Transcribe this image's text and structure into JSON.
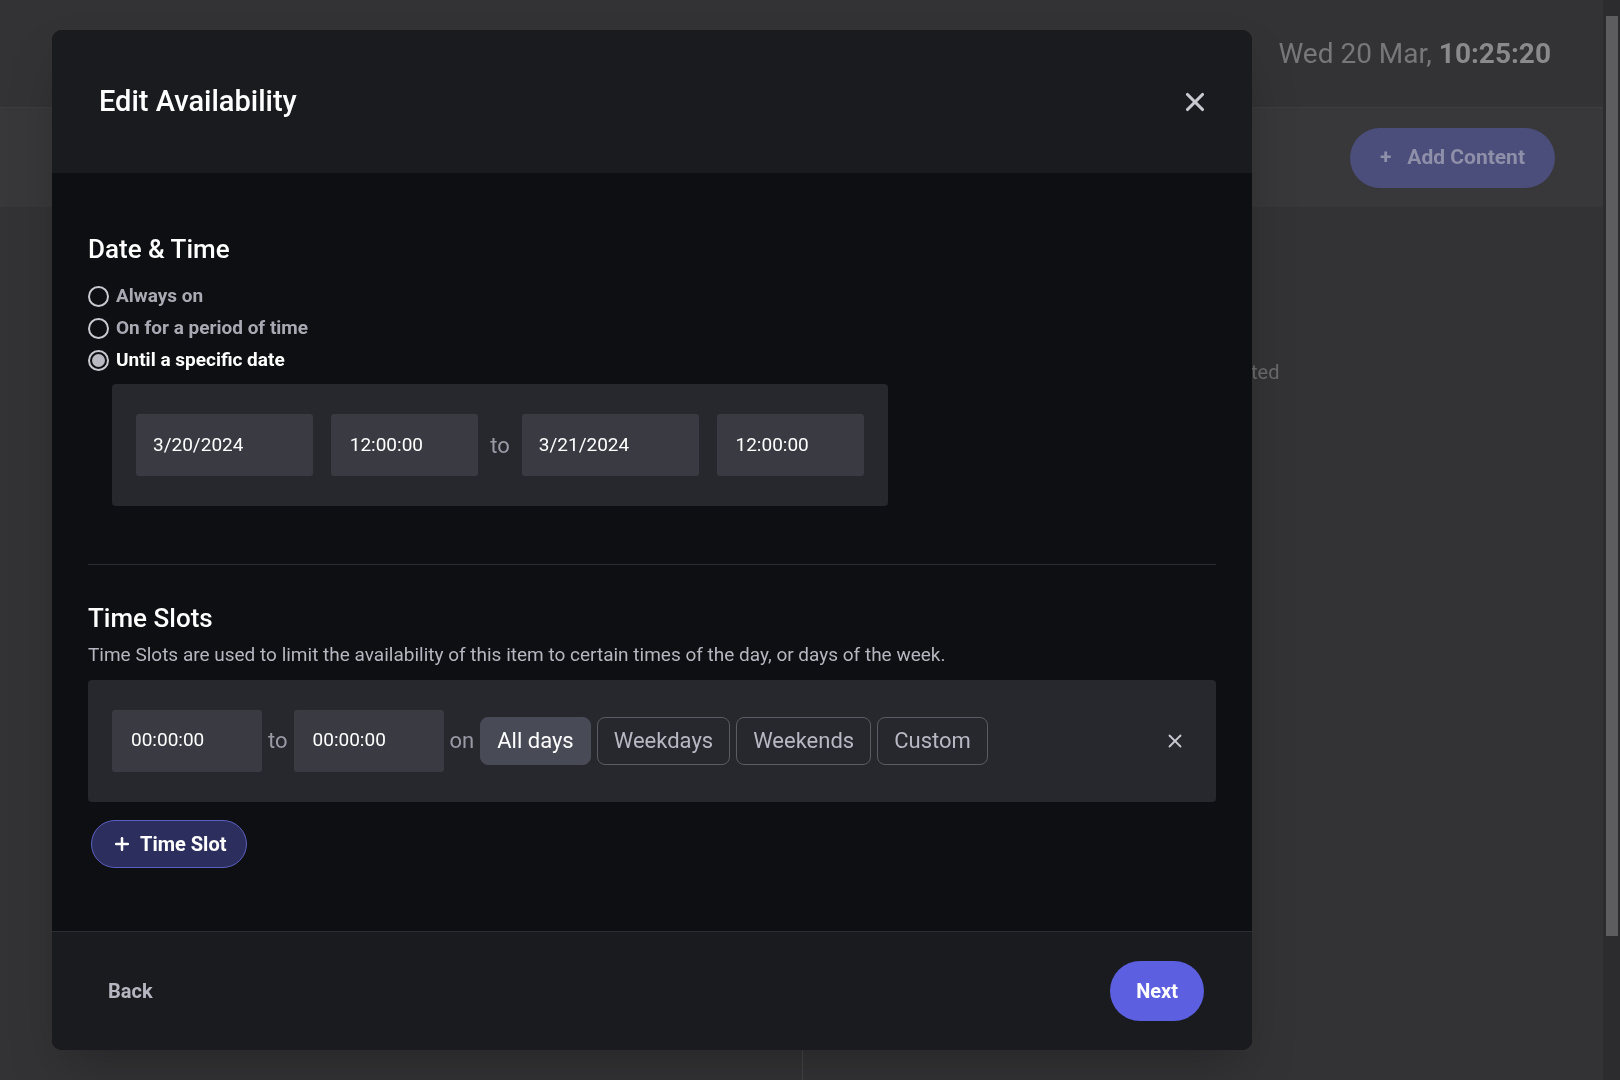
{
  "background": {
    "clock_date": "Wed 20 Mar,",
    "clock_time": "10:25:20",
    "add_button": {
      "icon": "+",
      "label": "Add Content"
    },
    "partial_text": "ted"
  },
  "dialog": {
    "title": "Edit Availability",
    "date_time": {
      "heading": "Date & Time",
      "options": [
        {
          "label": "Always on",
          "selected": false
        },
        {
          "label": "On for a period of time",
          "selected": false
        },
        {
          "label": "Until a specific date",
          "selected": true
        }
      ],
      "start_date": "3/20/2024",
      "start_time": "12:00:00",
      "separator": "to",
      "end_date": "3/21/2024",
      "end_time": "12:00:00"
    },
    "time_slots": {
      "heading": "Time Slots",
      "description": "Time Slots are used to limit the availability of this item to certain times of the day, or days of the week.",
      "slots": [
        {
          "from": "00:00:00",
          "separator": "to",
          "to": "00:00:00",
          "on_label": "on",
          "days": [
            {
              "label": "All days",
              "selected": true
            },
            {
              "label": "Weekdays",
              "selected": false
            },
            {
              "label": "Weekends",
              "selected": false
            },
            {
              "label": "Custom",
              "selected": false
            }
          ]
        }
      ],
      "add_button": {
        "label": "Time Slot"
      }
    },
    "footer": {
      "back": "Back",
      "next": "Next"
    }
  }
}
